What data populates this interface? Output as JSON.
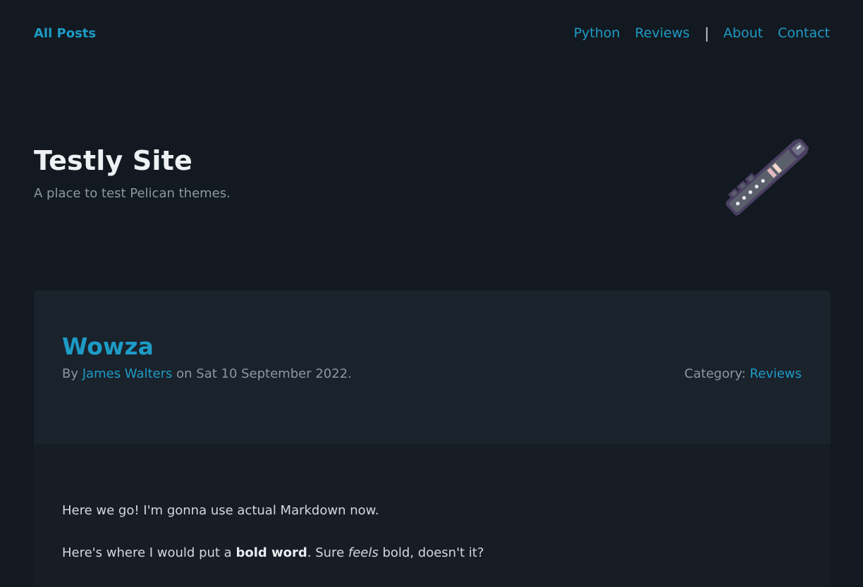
{
  "nav": {
    "brand": "All Posts",
    "items": [
      "Python",
      "Reviews",
      "About",
      "Contact"
    ],
    "separator": "|"
  },
  "hero": {
    "title": "Testly Site",
    "subtitle": "A place to test Pelican themes.",
    "logo_icon": "recorder-flute-icon"
  },
  "article": {
    "title": "Wowza",
    "by_label": "By",
    "author": "James Walters",
    "date_text": "on Sat 10 September 2022.",
    "category_label": "Category:",
    "category": "Reviews",
    "paragraph1": "Here we go! I'm gonna use actual Markdown now.",
    "paragraph2": {
      "before_bold": "Here's where I would put a ",
      "bold": "bold word",
      "between": ". Sure ",
      "italic": "feels",
      "after": " bold, doesn't it?"
    }
  },
  "colors": {
    "background": "#131920",
    "card_header": "#1a222b",
    "card_body": "#161d25",
    "accent": "#1d9bc6",
    "muted_text": "#8e979f",
    "heading_text": "#eef1f4"
  }
}
